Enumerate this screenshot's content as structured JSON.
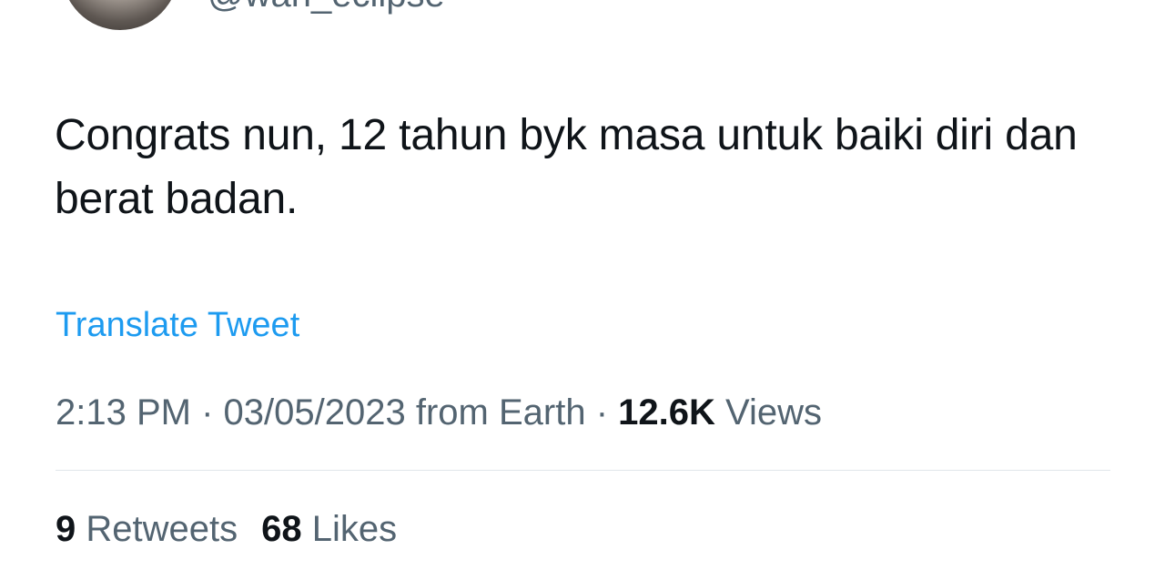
{
  "author": {
    "handle": "@wan_eclipse"
  },
  "tweet": {
    "text": "Congrats nun, 12 tahun byk masa untuk baiki diri dan berat badan.",
    "translate_label": "Translate Tweet",
    "time": "2:13 PM",
    "separator": "·",
    "date": "03/05/2023",
    "source": "from Earth",
    "views_count": "12.6K",
    "views_label": "Views"
  },
  "stats": {
    "retweets_count": "9",
    "retweets_label": "Retweets",
    "likes_count": "68",
    "likes_label": "Likes"
  }
}
